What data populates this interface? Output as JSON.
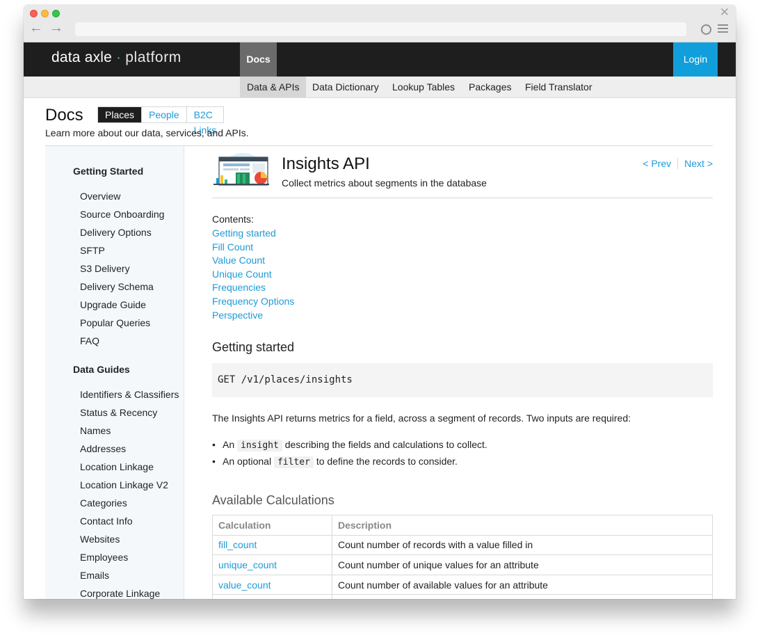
{
  "brand": {
    "name": "data axle",
    "separator": "·",
    "product": "platform"
  },
  "topbar": {
    "docs_label": "Docs",
    "login_label": "Login"
  },
  "subnav": {
    "items": [
      {
        "label": "Data & APIs",
        "active": true
      },
      {
        "label": "Data Dictionary",
        "active": false
      },
      {
        "label": "Lookup Tables",
        "active": false
      },
      {
        "label": "Packages",
        "active": false
      },
      {
        "label": "Field Translator",
        "active": false
      }
    ]
  },
  "page": {
    "title": "Docs",
    "subtitle": "Learn more about our data, services, and APIs.",
    "tabs": [
      {
        "label": "Places",
        "active": true
      },
      {
        "label": "People",
        "active": false
      },
      {
        "label": "B2C Links",
        "active": false
      }
    ]
  },
  "sidebar": {
    "sections": [
      {
        "title": "Getting Started",
        "items": [
          "Overview",
          "Source Onboarding",
          "Delivery Options",
          "SFTP",
          "S3 Delivery",
          "Delivery Schema",
          "Upgrade Guide",
          "Popular Queries",
          "FAQ"
        ]
      },
      {
        "title": "Data Guides",
        "items": [
          "Identifiers & Classifiers",
          "Status & Recency",
          "Names",
          "Addresses",
          "Location Linkage",
          "Location Linkage V2",
          "Categories",
          "Contact Info",
          "Websites",
          "Employees",
          "Emails",
          "Corporate Linkage"
        ]
      }
    ]
  },
  "article": {
    "title": "Insights API",
    "subtitle": "Collect metrics about segments in the database",
    "prev_label": "< Prev",
    "next_label": "Next >",
    "contents_label": "Contents:",
    "toc": [
      "Getting started",
      "Fill Count",
      "Value Count",
      "Unique Count",
      "Frequencies",
      "Frequency Options",
      "Perspective"
    ],
    "getting_started_heading": "Getting started",
    "code": "GET /v1/places/insights",
    "intro": "The Insights API returns metrics for a field, across a segment of records. Two inputs are required:",
    "bullets": [
      {
        "pre": "An",
        "code": "insight",
        "post": "describing the fields and calculations to collect."
      },
      {
        "pre": "An optional",
        "code": "filter",
        "post": "to define the records to consider."
      }
    ],
    "available_heading": "Available Calculations",
    "table": {
      "headers": [
        "Calculation",
        "Description"
      ],
      "rows": [
        [
          "fill_count",
          "Count number of records with a value filled in"
        ],
        [
          "unique_count",
          "Count number of unique values for an attribute"
        ],
        [
          "value_count",
          "Count number of available values for an attribute"
        ],
        [
          "",
          ""
        ]
      ]
    }
  },
  "colors": {
    "accent": "#1d9ad6",
    "login": "#119fdb",
    "topbar": "#1e1e1e"
  }
}
